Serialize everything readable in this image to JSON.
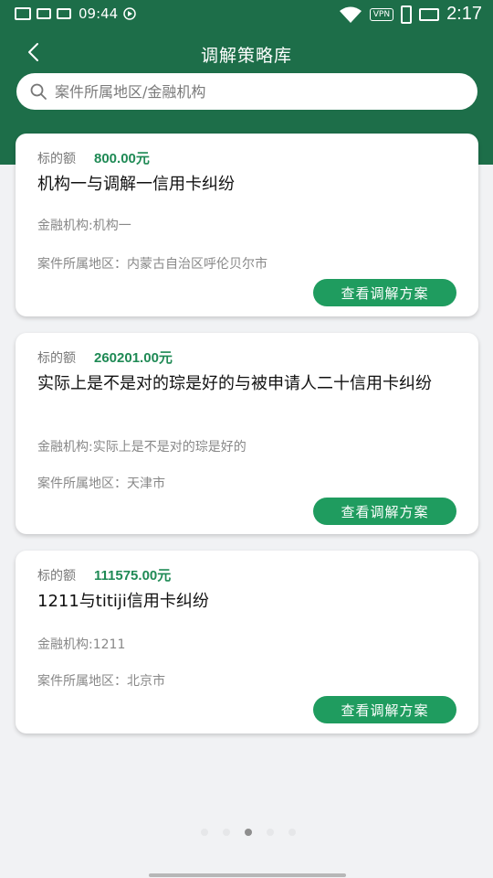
{
  "status_bar": {
    "time": "09:44",
    "clock": "2:17",
    "vpn": "VPN"
  },
  "header": {
    "title": "调解策略库"
  },
  "search": {
    "placeholder": "案件所属地区/金融机构"
  },
  "cases": [
    {
      "amount_label": "标的额",
      "amount": "800.00元",
      "title": "机构一与调解一信用卡纠纷",
      "institution": "金融机构:机构一",
      "region": "案件所属地区：内蒙古自治区呼伦贝尔市",
      "button": "查看调解方案"
    },
    {
      "amount_label": "标的额",
      "amount": "260201.00元",
      "title": "实际上是不是对的琮是好的与被申请人二十信用卡纠纷",
      "institution": "金融机构:实际上是不是对的琮是好的",
      "region": "案件所属地区：天津市",
      "button": "查看调解方案"
    },
    {
      "amount_label": "标的额",
      "amount": "111575.00元",
      "title": "1211与titiji信用卡纠纷",
      "institution": "金融机构:1211",
      "region": "案件所属地区：北京市",
      "button": "查看调解方案"
    }
  ],
  "colors": {
    "header_green": "#1d6e49",
    "button_green": "#1f9c5f",
    "amount_green": "#1f8a55"
  },
  "icons": [
    "back-arrow-icon",
    "search-icon",
    "image-icon",
    "app-icon",
    "hd-icon",
    "play-icon",
    "wifi-icon",
    "vpn-icon",
    "battery-icon"
  ]
}
